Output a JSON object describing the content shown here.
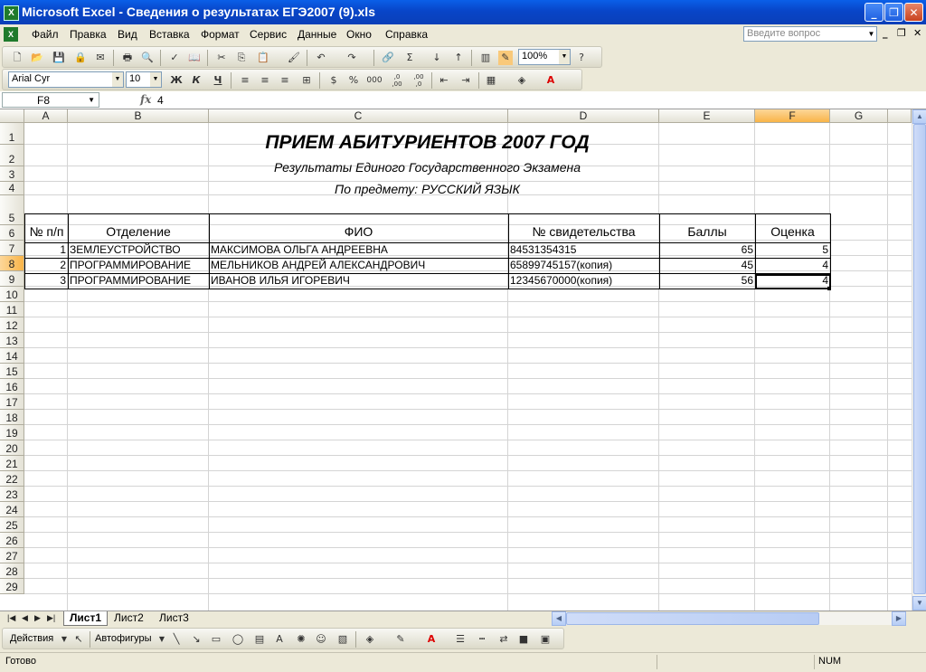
{
  "window": {
    "title": "Microsoft Excel - Сведения о результатах ЕГЭ2007 (9).xls",
    "app_icon": "excel-icon"
  },
  "menu": {
    "items": [
      "Файл",
      "Правка",
      "Вид",
      "Вставка",
      "Формат",
      "Сервис",
      "Данные",
      "Окно",
      "Справка"
    ],
    "ask_placeholder": "Введите вопрос"
  },
  "toolbar": {
    "zoom": "100%",
    "font_name": "Arial Cyr",
    "font_size": "10",
    "bold_label": "Ж",
    "italic_label": "К",
    "underline_label": "Ч",
    "percent_label": "%",
    "thousands_label": "000",
    "inc_decimal_label": ",0 ,00",
    "dec_decimal_label": ",00 ,0"
  },
  "formula_bar": {
    "name_box": "F8",
    "fx_label": "fx",
    "value": "4"
  },
  "columns": [
    "A",
    "B",
    "C",
    "D",
    "E",
    "F",
    "G"
  ],
  "rows": [
    "1",
    "2",
    "3",
    "4",
    "5",
    "6",
    "7",
    "8",
    "9",
    "10",
    "11",
    "12",
    "13",
    "14",
    "15",
    "16",
    "17",
    "18",
    "19",
    "20",
    "21",
    "22",
    "23",
    "24",
    "25",
    "26",
    "27",
    "28",
    "29"
  ],
  "sheet": {
    "title": "ПРИЕМ АБИТУРИЕНТОВ 2007 ГОД",
    "subtitle": "Результаты Единого Государственного Экзамена",
    "subject": "По предмету: РУССКИЙ ЯЗЫК",
    "headers": {
      "num": "№ п/п",
      "department": "Отделение",
      "fio": "ФИО",
      "certificate": "№ свидетельства",
      "score": "Баллы",
      "grade": "Оценка"
    },
    "records": [
      {
        "num": "1",
        "department": "ЗЕМЛЕУСТРОЙСТВО",
        "fio": "МАКСИМОВА ОЛЬГА АНДРЕЕВНА",
        "certificate": "84531354315",
        "score": "65",
        "grade": "5"
      },
      {
        "num": "2",
        "department": "ПРОГРАММИРОВАНИЕ",
        "fio": "МЕЛЬНИКОВ АНДРЕЙ АЛЕКСАНДРОВИЧ",
        "certificate": "65899745157(копия)",
        "score": "45",
        "grade": "4"
      },
      {
        "num": "3",
        "department": "ПРОГРАММИРОВАНИЕ",
        "fio": "ИВАНОВ ИЛЬЯ ИГОРЕВИЧ",
        "certificate": "12345670000(копия)",
        "score": "56",
        "grade": "4"
      }
    ]
  },
  "tabs": [
    "Лист1",
    "Лист2",
    "Лист3"
  ],
  "drawing": {
    "actions_label": "Действия",
    "autoshapes_label": "Автофигуры"
  },
  "status": {
    "text": "Готово",
    "num": "NUM"
  }
}
